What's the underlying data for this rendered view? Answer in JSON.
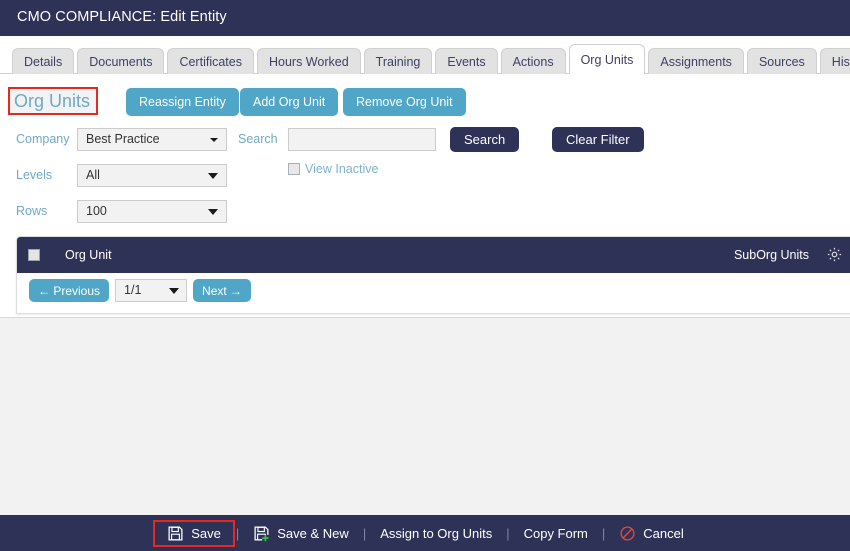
{
  "window": {
    "title": "CMO COMPLIANCE: Edit Entity"
  },
  "tabs": [
    {
      "label": "Details",
      "active": false
    },
    {
      "label": "Documents",
      "active": false
    },
    {
      "label": "Certificates",
      "active": false
    },
    {
      "label": "Hours Worked",
      "active": false
    },
    {
      "label": "Training",
      "active": false
    },
    {
      "label": "Events",
      "active": false
    },
    {
      "label": "Actions",
      "active": false
    },
    {
      "label": "Org Units",
      "active": true
    },
    {
      "label": "Assignments",
      "active": false
    },
    {
      "label": "Sources",
      "active": false
    },
    {
      "label": "History",
      "active": false
    }
  ],
  "section": {
    "heading": "Org Units",
    "heading_highlighted": true,
    "actions": {
      "reassign_entity": "Reassign Entity",
      "add_org_unit": "Add Org Unit",
      "remove_org_unit": "Remove Org Unit"
    }
  },
  "filters": {
    "company": {
      "label": "Company",
      "value": "Best Practice"
    },
    "levels": {
      "label": "Levels",
      "value": "All"
    },
    "rows": {
      "label": "Rows",
      "value": "100"
    },
    "search": {
      "label": "Search",
      "value": "",
      "placeholder": ""
    },
    "view_inactive": {
      "label": "View Inactive",
      "checked": false
    },
    "search_button": "Search",
    "clear_filter_button": "Clear Filter"
  },
  "grid": {
    "columns": {
      "org_unit": "Org Unit",
      "suborg_units": "SubOrg Units"
    },
    "select_all_checked": false,
    "settings_icon": "gear-icon",
    "rows": [],
    "pager": {
      "previous": "← Previous",
      "page_value": "1/1",
      "next": "Next →"
    }
  },
  "footer": {
    "items": [
      {
        "label": "Save",
        "icon": "floppy-disk-icon",
        "highlighted": true
      },
      {
        "label": "Save & New",
        "icon": "floppy-disk-plus-icon",
        "highlighted": false
      },
      {
        "label": "Assign to Org Units",
        "icon": "none",
        "highlighted": false
      },
      {
        "label": "Copy Form",
        "icon": "none",
        "highlighted": false
      },
      {
        "label": "Cancel",
        "icon": "no-entry-icon",
        "highlighted": false
      }
    ],
    "separator": "|"
  },
  "colors": {
    "navy": "#2e3256",
    "teal": "#4fa6c6",
    "heading_blue": "#6fa9c4",
    "label_blue": "#6fa9c4",
    "highlight_red": "#e8281e",
    "page_background": "#f2f2f2"
  }
}
